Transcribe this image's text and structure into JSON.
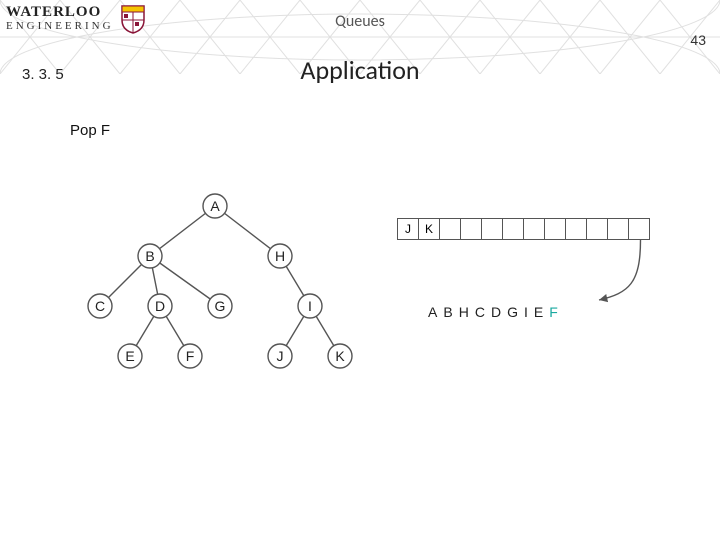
{
  "header": {
    "title": "Queues",
    "page_number": "43"
  },
  "section": {
    "number": "3. 3. 5",
    "title": "Application"
  },
  "body": {
    "text": "Pop F"
  },
  "chart_data": {
    "type": "tree",
    "tree": {
      "nodes": [
        "A",
        "B",
        "C",
        "D",
        "E",
        "F",
        "G",
        "H",
        "I",
        "J",
        "K"
      ],
      "edges": [
        [
          "A",
          "B"
        ],
        [
          "A",
          "H"
        ],
        [
          "B",
          "C"
        ],
        [
          "B",
          "D"
        ],
        [
          "B",
          "G"
        ],
        [
          "D",
          "E"
        ],
        [
          "D",
          "F"
        ],
        [
          "H",
          "I"
        ],
        [
          "I",
          "J"
        ],
        [
          "I",
          "K"
        ]
      ]
    },
    "queue": {
      "capacity": 12,
      "contents": [
        "J",
        "K",
        "",
        "",
        "",
        "",
        "",
        "",
        "",
        "",
        "",
        ""
      ],
      "arrow_from_index": 11,
      "arrow_to_output_index": 9
    },
    "output_sequence": [
      "A",
      "B",
      "H",
      "C",
      "D",
      "G",
      "I",
      "E",
      "F"
    ],
    "highlight_last_output": true,
    "accent_color": "#1aa9a0"
  },
  "logo": {
    "line1": "WATERLOO",
    "line2": "ENGINEERING"
  }
}
